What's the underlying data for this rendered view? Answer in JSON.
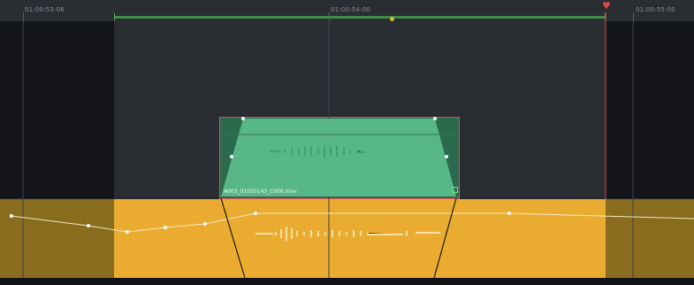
{
  "timeline": {
    "timecodes": [
      "01:00:53:06",
      "01:00:54:00",
      "01:00:55:00"
    ],
    "clip_name": "A003_01020143_C006.mov"
  },
  "colors": {
    "background": "#1f2226",
    "track_gap": "#14161a",
    "audio_clip": "#e9ac30",
    "audio_clip_dim": "#8a6c1f",
    "video_clip": "#5fc18f",
    "range_bar": "#3f8c46",
    "playhead": "#e04646"
  }
}
